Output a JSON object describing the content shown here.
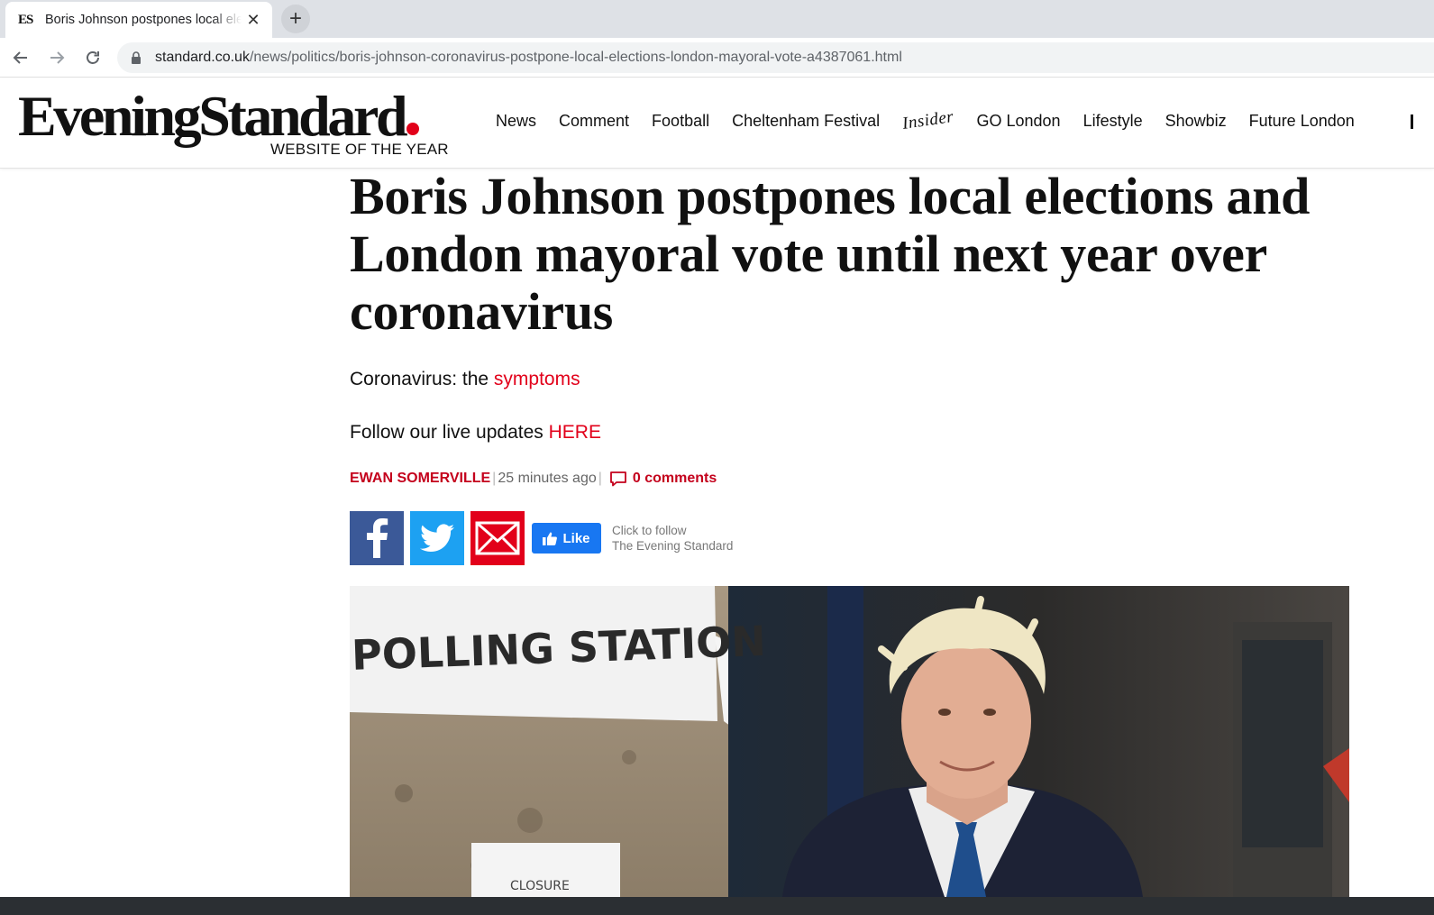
{
  "browser": {
    "tab": {
      "favicon_text": "ES",
      "title": "Boris Johnson postpones local elections and London mayoral vote"
    },
    "url_host": "standard.co.uk",
    "url_path": "/news/politics/boris-johnson-coronavirus-postpone-local-elections-london-mayoral-vote-a4387061.html"
  },
  "site": {
    "logo_name": "EveningStandard",
    "logo_tagline": "WEBSITE OF THE YEAR",
    "nav": {
      "news": "News",
      "comment": "Comment",
      "football": "Football",
      "cheltenham": "Cheltenham Festival",
      "insider": "Insider",
      "go_london": "GO London",
      "lifestyle": "Lifestyle",
      "showbiz": "Showbiz",
      "future_london": "Future London"
    }
  },
  "article": {
    "headline": "Boris Johnson postpones local elections and London mayoral vote until next year over coronavirus",
    "standfirst_1": {
      "text": "Coronavirus: the ",
      "link": "symptoms"
    },
    "standfirst_2": {
      "text": "Follow our live updates ",
      "link": "HERE"
    },
    "byline": {
      "author": "EWAN SOMERVILLE",
      "separator": "|",
      "time": "25 minutes ago",
      "comments": "0 comments"
    },
    "share": {
      "like_label": "Like",
      "follow_line1": "Click to follow",
      "follow_line2": "The Evening Standard"
    },
    "photo": {
      "sign_text": "POLLING STATION",
      "closure_text": "CLOSURE"
    }
  },
  "colors": {
    "brand_red": "#e2001a",
    "facebook": "#3b5998",
    "twitter": "#1da1f2",
    "like_blue": "#1877f2"
  }
}
